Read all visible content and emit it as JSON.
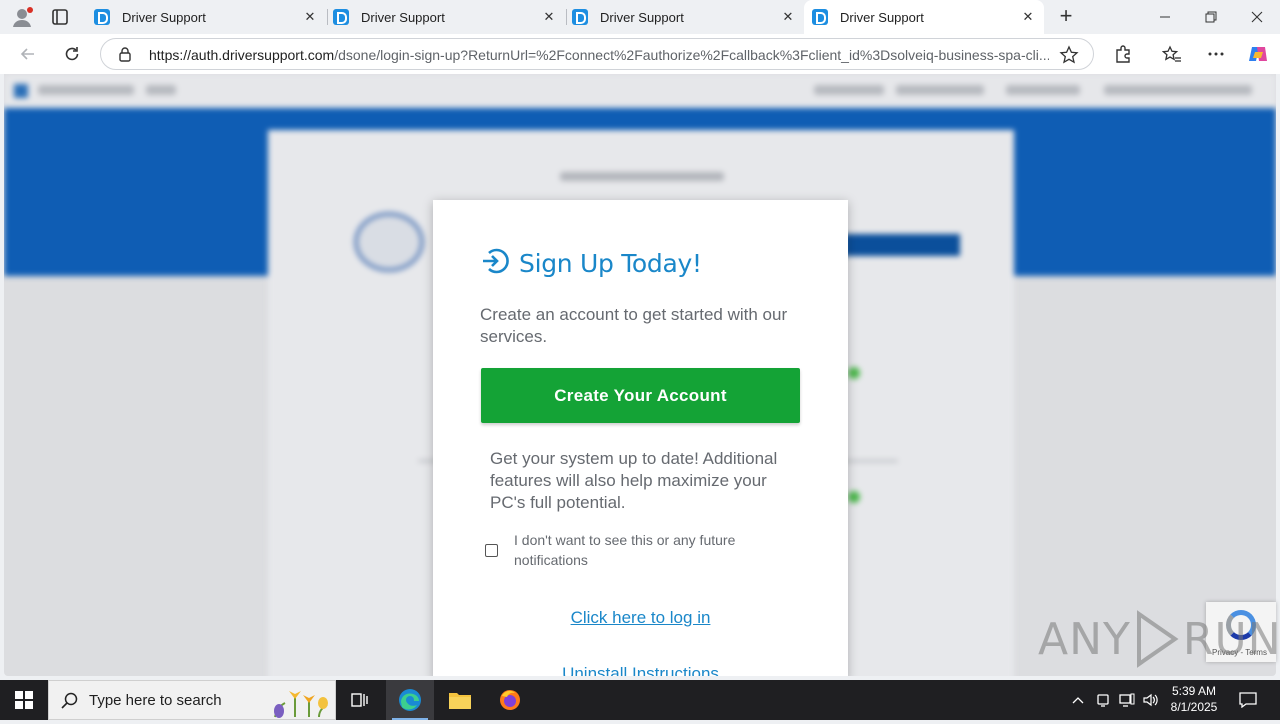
{
  "browser": {
    "tabs": [
      {
        "title": "Driver Support",
        "active": false
      },
      {
        "title": "Driver Support",
        "active": false
      },
      {
        "title": "Driver Support",
        "active": false
      },
      {
        "title": "Driver Support",
        "active": true
      }
    ],
    "url_host": "https://auth.driversupport.com",
    "url_path": "/dsone/login-sign-up?ReturnUrl=%2Fconnect%2Fauthorize%2Fcallback%3Fclient_id%3Dsolveiq-business-spa-cli..."
  },
  "modal": {
    "title": "Sign Up Today!",
    "subtitle": "Create an account to get started with our services.",
    "create_button": "Create Your Account",
    "body": "Get your system up to date! Additional features will also help maximize your PC's full potential.",
    "optout_label": "I don't want to see this or any future notifications",
    "optout_checked": false,
    "login_link": "Click here to log in",
    "uninstall_link": "Uninstall Instructions"
  },
  "recaptcha": {
    "terms": "Privacy - Terms"
  },
  "watermark": {
    "left": "ANY",
    "right": "RUN"
  },
  "taskbar": {
    "search_placeholder": "Type here to search",
    "time": "5:39 AM",
    "date": "8/1/2025"
  },
  "colors": {
    "accent": "#1a87c9",
    "create_button": "#14a336",
    "band": "#0f5db4"
  }
}
